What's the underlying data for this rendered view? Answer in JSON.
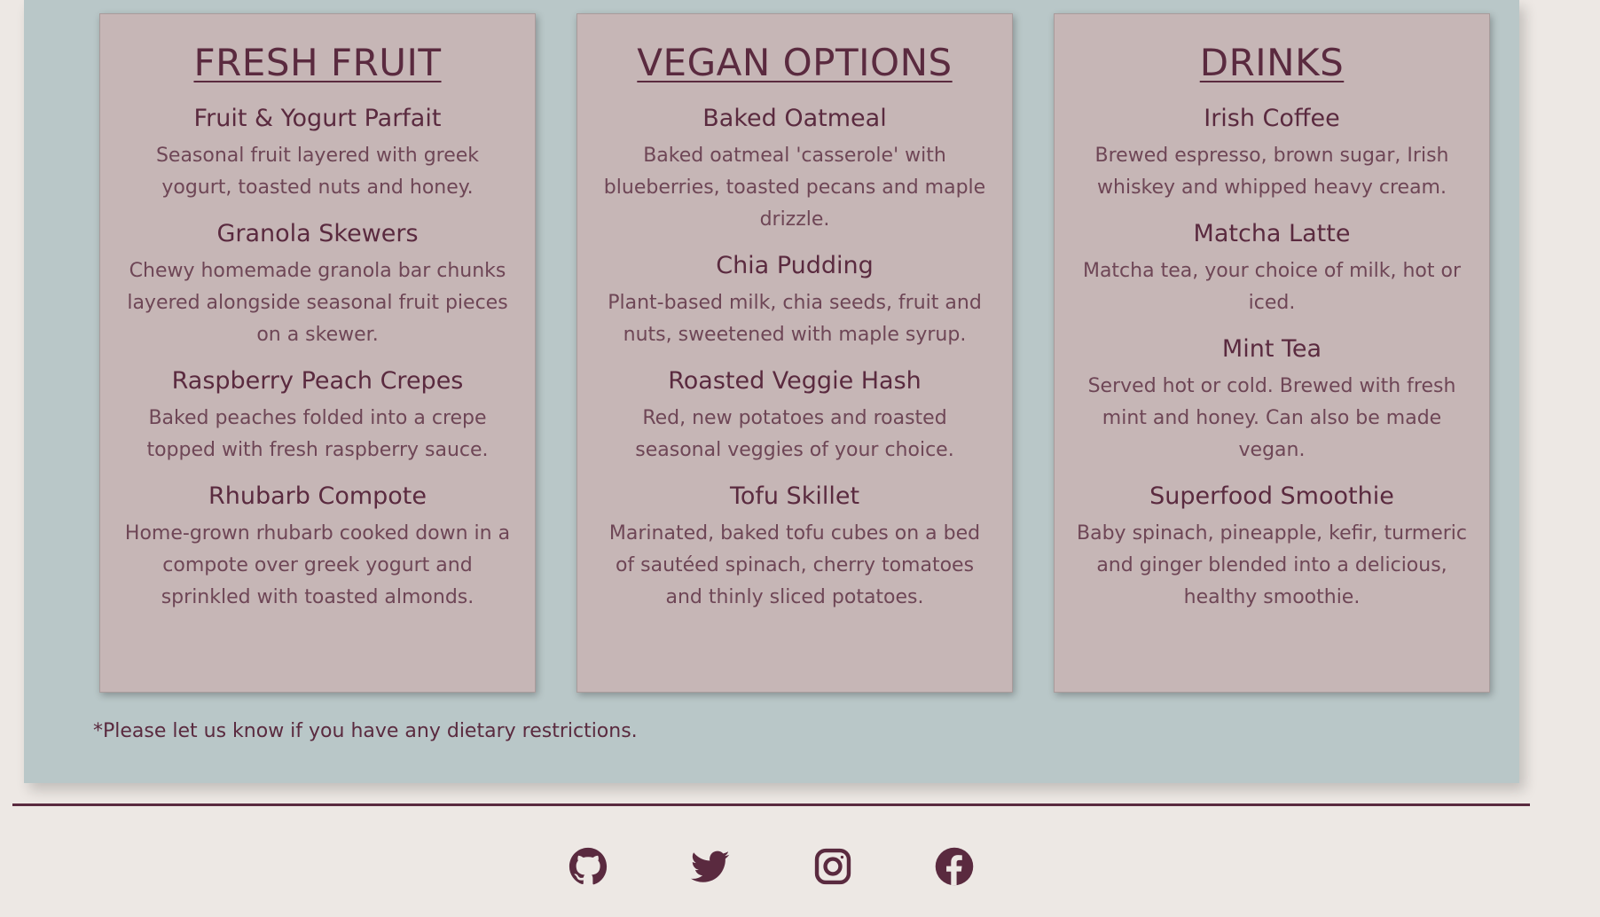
{
  "menu": {
    "cards": [
      {
        "title": "FRESH FRUIT",
        "items": [
          {
            "name": "Fruit & Yogurt Parfait",
            "desc": "Seasonal fruit layered with greek yogurt, toasted nuts and honey."
          },
          {
            "name": "Granola Skewers",
            "desc": "Chewy homemade granola bar chunks layered alongside seasonal fruit pieces on a skewer."
          },
          {
            "name": "Raspberry Peach Crepes",
            "desc": "Baked peaches folded into a crepe topped with fresh raspberry sauce."
          },
          {
            "name": "Rhubarb Compote",
            "desc": "Home-grown rhubarb cooked down in a compote over greek yogurt and sprinkled with toasted almonds."
          }
        ]
      },
      {
        "title": "VEGAN OPTIONS",
        "items": [
          {
            "name": "Baked Oatmeal",
            "desc": "Baked oatmeal 'casserole' with blueberries, toasted pecans and maple drizzle."
          },
          {
            "name": "Chia Pudding",
            "desc": "Plant-based milk, chia seeds, fruit and nuts, sweetened with maple syrup."
          },
          {
            "name": "Roasted Veggie Hash",
            "desc": "Red, new potatoes and roasted seasonal veggies of your choice."
          },
          {
            "name": "Tofu Skillet",
            "desc": "Marinated, baked tofu cubes on a bed of sautéed spinach, cherry tomatoes and thinly sliced potatoes."
          }
        ]
      },
      {
        "title": "DRINKS",
        "items": [
          {
            "name": "Irish Coffee",
            "desc": "Brewed espresso, brown sugar, Irish whiskey and whipped heavy cream."
          },
          {
            "name": "Matcha Latte",
            "desc": "Matcha tea, your choice of milk, hot or iced."
          },
          {
            "name": "Mint Tea",
            "desc": "Served hot or cold. Brewed with fresh mint and honey. Can also be made vegan."
          },
          {
            "name": "Superfood Smoothie",
            "desc": "Baby spinach, pineapple, kefir, turmeric and ginger blended into a delicious, healthy smoothie."
          }
        ]
      }
    ],
    "note": "*Please let us know if you have any dietary restrictions."
  },
  "footer": {
    "icons": [
      "github-icon",
      "twitter-icon",
      "instagram-icon",
      "facebook-icon"
    ]
  },
  "colors": {
    "page_bg": "#ede8e4",
    "panel_bg": "#b9c7c8",
    "card_bg": "#c6b6b6",
    "text": "#5a2a3f"
  }
}
